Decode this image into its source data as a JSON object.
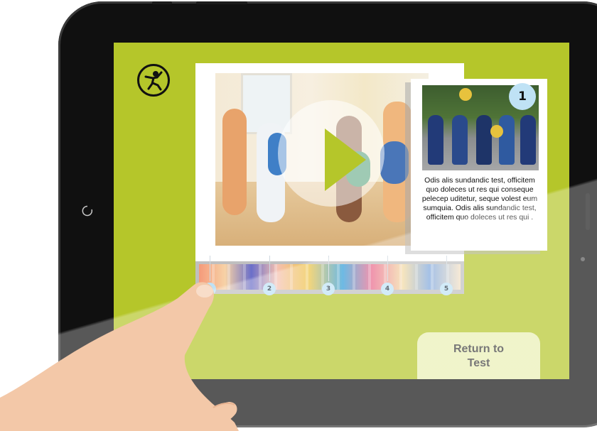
{
  "logo": {
    "icon": "dancer-logo-icon"
  },
  "video": {
    "play_icon": "play-icon",
    "accent_color": "#b5c62a"
  },
  "timeline": {
    "markers": [
      "1",
      "2",
      "3",
      "4",
      "5"
    ]
  },
  "info_card": {
    "number": "1",
    "text": "Odis alis sundandic test, officitem quo doleces ut res qui conseque pelecep uditetur, seque volest eum sumquia. Odis alis sundandic test, officitem quo doleces ut res qui ."
  },
  "return_button": {
    "line1": "Return to",
    "line2": "Test"
  },
  "colors": {
    "screen_bg": "#b5c62a",
    "badge": "#bfe2f5",
    "button_bg": "#e9efb4"
  }
}
